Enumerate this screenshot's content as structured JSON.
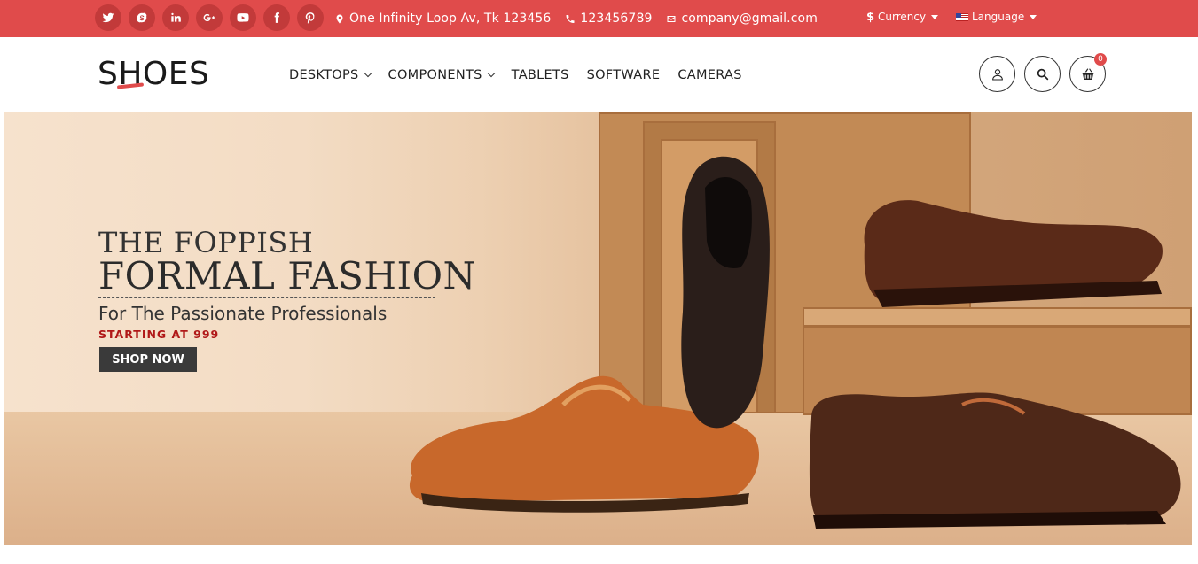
{
  "topbar": {
    "social_icons": [
      "twitter-icon",
      "skype-icon",
      "linkedin-icon",
      "google-plus-icon",
      "youtube-icon",
      "facebook-icon",
      "pinterest-icon"
    ],
    "address": "One Infinity Loop Av, Tk 123456",
    "phone": "123456789",
    "email": "company@gmail.com",
    "currency_label": "Currency",
    "currency_symbol": "$",
    "language_label": "Language"
  },
  "header": {
    "logo_text": "SHOES",
    "nav": [
      {
        "label": "DESKTOPS",
        "has_dropdown": true
      },
      {
        "label": "COMPONENTS",
        "has_dropdown": true
      },
      {
        "label": "TABLETS",
        "has_dropdown": false
      },
      {
        "label": "SOFTWARE",
        "has_dropdown": false
      },
      {
        "label": "CAMERAS",
        "has_dropdown": false
      }
    ],
    "cart_count": "0"
  },
  "banner": {
    "line1": "THE FOPPISH",
    "line2": "FORMAL FASHION",
    "line3": "For The Passionate Professionals",
    "price": "STARTING AT 999",
    "cta": "SHOP NOW"
  },
  "colors": {
    "accent": "#e04b4b",
    "dark": "#3a3a3a"
  }
}
